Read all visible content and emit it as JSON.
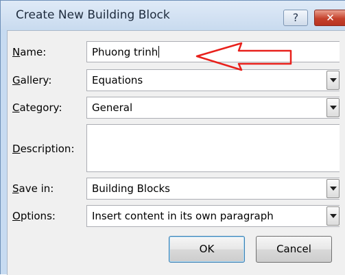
{
  "window": {
    "title": "Create New Building Block",
    "help_label": "?",
    "close_label": "✕"
  },
  "form": {
    "name": {
      "label_acc": "N",
      "label_rest": "ame:",
      "value": "Phuong trinh"
    },
    "gallery": {
      "label_acc": "G",
      "label_rest": "allery:",
      "value": "Equations"
    },
    "category": {
      "label_acc": "C",
      "label_rest": "ategory:",
      "value": "General"
    },
    "description": {
      "label_acc": "D",
      "label_rest": "escription:",
      "value": ""
    },
    "save_in": {
      "label_acc": "S",
      "label_rest": "ave in:",
      "value": "Building Blocks"
    },
    "options": {
      "label_acc": "O",
      "label_rest": "ptions:",
      "value": "Insert content in its own paragraph"
    }
  },
  "buttons": {
    "ok_label": "OK",
    "cancel_label": "Cancel"
  },
  "annotation": {
    "arrow_color": "#e8201b"
  }
}
